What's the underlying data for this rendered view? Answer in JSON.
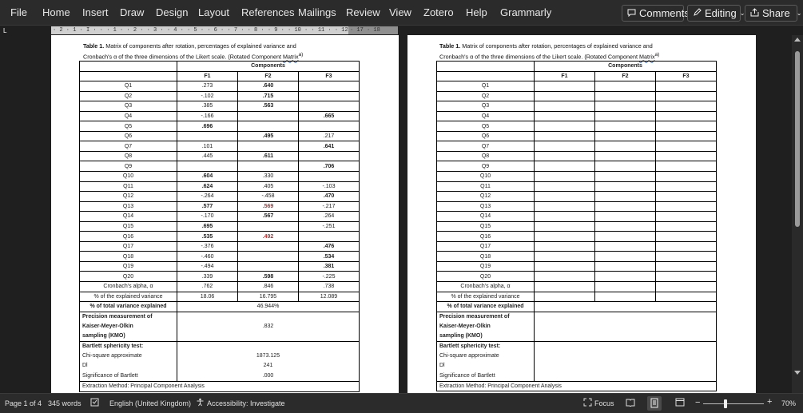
{
  "ribbon": {
    "menu": [
      "File",
      "Home",
      "Insert",
      "Draw",
      "Design",
      "Layout",
      "References",
      "Mailings",
      "Review",
      "View",
      "Zotero",
      "Help",
      "Grammarly"
    ],
    "comments_label": "Comments",
    "editing_label": "Editing",
    "share_label": "Share"
  },
  "ruler": {
    "text": "· 2 · 1 · I · · · 1 · · 2 · · 3 · · 4 · · 5 · · 6 · · 7 · · 8 · · 9 · · 10 · · 11 · · 12 · · 13 · · 14 · · 15 ·",
    "text_right": "· 17 · 18",
    "tab_marker": "L"
  },
  "document": {
    "caption_line1_bold": "Table 1.",
    "caption_line1": " Matrix of components after rotation, percentages of explained variance and",
    "caption_line2": "Cronbach's α of the three dimensions of the Likert scale. (Rotated Component ",
    "caption_line2_link": "Matrix",
    "caption_sup": "a)",
    "header_components": "Components",
    "columns": [
      "F1",
      "F2",
      "F3"
    ],
    "rows": [
      {
        "label": "Q1",
        "f1": ".273",
        "f2": ".640",
        "f3": ""
      },
      {
        "label": "Q2",
        "f1": "-.102",
        "f2": ".715",
        "f3": ""
      },
      {
        "label": "Q3",
        "f1": ".385",
        "f2": ".563",
        "f3": ""
      },
      {
        "label": "Q4",
        "f1": "-.166",
        "f2": "",
        "f3": ".665"
      },
      {
        "label": "Q5",
        "f1": ".696",
        "f2": "",
        "f3": ""
      },
      {
        "label": "Q6",
        "f1": "",
        "f2": ".495",
        "f3": ".217"
      },
      {
        "label": "Q7",
        "f1": ".101",
        "f2": "",
        "f3": ".641"
      },
      {
        "label": "Q8",
        "f1": ".445",
        "f2": ".611",
        "f3": ""
      },
      {
        "label": "Q9",
        "f1": "",
        "f2": "",
        "f3": ".706"
      },
      {
        "label": "Q10",
        "f1": ".604",
        "f2": ".330",
        "f3": ""
      },
      {
        "label": "Q11",
        "f1": ".624",
        "f2": ".405",
        "f3": "-.103"
      },
      {
        "label": "Q12",
        "f1": "-.264",
        "f2": "-.458",
        "f3": ".470"
      },
      {
        "label": "Q13",
        "f1": ".577",
        "f2": ".569",
        "f3": "-.217"
      },
      {
        "label": "Q14",
        "f1": "-.170",
        "f2": ".567",
        "f3": ".264"
      },
      {
        "label": "Q15",
        "f1": ".695",
        "f2": "",
        "f3": "-.251"
      },
      {
        "label": "Q16",
        "f1": ".535",
        "f2": ".492",
        "f3": ""
      },
      {
        "label": "Q17",
        "f1": "-.376",
        "f2": "",
        "f3": ".476"
      },
      {
        "label": "Q18",
        "f1": "-.460",
        "f2": "",
        "f3": ".534"
      },
      {
        "label": "Q19",
        "f1": "-.494",
        "f2": "",
        "f3": ".381"
      },
      {
        "label": "Q20",
        "f1": ".339",
        "f2": ".598",
        "f3": "-.225"
      }
    ],
    "cronbach_label": "Cronbach's alpha, α",
    "cronbach": [
      ".762",
      ".846",
      ".738"
    ],
    "explained_label": "% of the explained variance",
    "explained": [
      "18.06",
      "16.795",
      "12.089"
    ],
    "total_label": "% of total variance explained",
    "total_value": "46.944%",
    "kmo_line1": "Precision measurement of",
    "kmo_line2": "Kaiser-Meyer-Olkin",
    "kmo_line3": "sampling (KMO)",
    "kmo_value": ".832",
    "bartlett_label": "Bartlett sphericity test:",
    "chi_label": "Chi-square approximate",
    "chi_value": "1873.125",
    "df_label": "Dl",
    "df_value": "241",
    "sig_label": "Significance of Bartlett",
    "sig_value": ".000",
    "extraction_label": "Extraction Method: Principal Component Analysis"
  },
  "statusbar": {
    "page": "Page 1 of 4",
    "words": "345 words",
    "language": "English (United Kingdom)",
    "accessibility": "Accessibility: Investigate",
    "focus": "Focus",
    "zoom": "70%"
  },
  "colors": {
    "ribbon_bg": "#2b2b2b",
    "canvas_bg": "#1f1f1f",
    "highlight_red": "#e02020"
  }
}
